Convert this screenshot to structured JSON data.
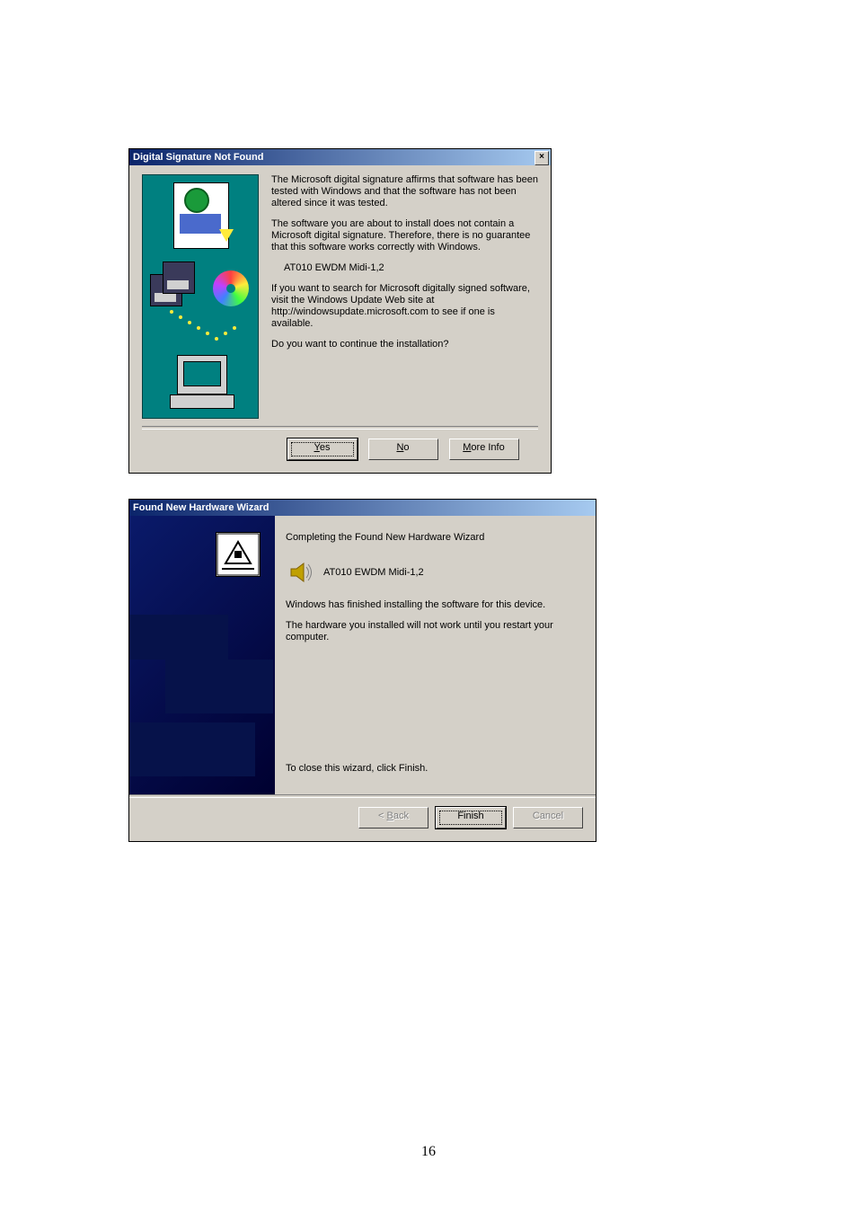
{
  "page_number": "16",
  "dialog1": {
    "title": "Digital Signature Not Found",
    "close_glyph": "×",
    "para1": "The Microsoft digital signature affirms that software has been tested with Windows and that the software has not been altered since it was tested.",
    "para2": "The software you are about to install does not contain a Microsoft digital signature. Therefore,  there is no guarantee that this software works correctly with Windows.",
    "device": "AT010 EWDM Midi-1,2",
    "para3": "If you want to search for Microsoft digitally signed software, visit the Windows Update Web site at http://windowsupdate.microsoft.com to see if one is available.",
    "para4": "Do you want to continue the installation?",
    "yes_u": "Y",
    "yes_rest": "es",
    "no_u": "N",
    "no_rest": "o",
    "more_u": "M",
    "more_rest": "ore Info"
  },
  "dialog2": {
    "title": "Found New Hardware Wizard",
    "heading": "Completing the Found New Hardware Wizard",
    "device": "AT010 EWDM Midi-1,2",
    "line1": "Windows has finished installing the software for this device.",
    "line2": "The hardware you installed will not work until you restart your computer.",
    "close_hint": "To close this wizard, click Finish.",
    "back_lt": "< ",
    "back_u": "B",
    "back_rest": "ack",
    "finish": "Finish",
    "cancel": "Cancel"
  }
}
